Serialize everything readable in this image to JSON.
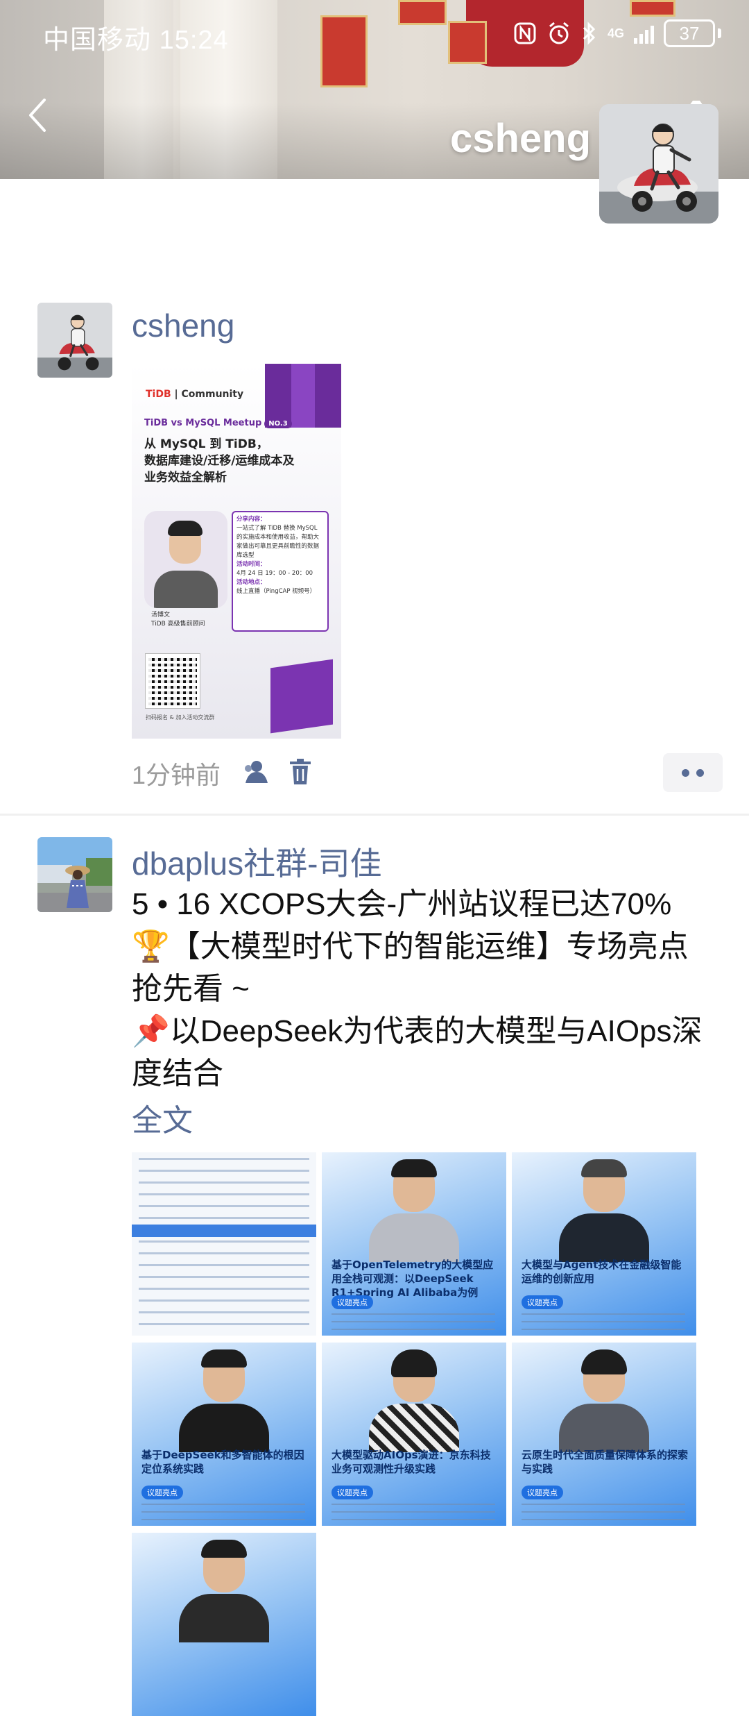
{
  "status_bar": {
    "carrier": "中国移动",
    "time": "15:24",
    "network": "4G",
    "battery": "37"
  },
  "header": {
    "cover_name": "csheng"
  },
  "posts": [
    {
      "author": "csheng",
      "image": {
        "brand_prefix": "TiDB",
        "brand_suffix": "| Community",
        "meetup": "TiDB vs MySQL Meetup",
        "meetup_no": "NO.3",
        "headline_1": "从 MySQL 到 TiDB，",
        "headline_2": "数据库建设/迁移/运维成本及",
        "headline_3": "业务效益全解析",
        "speaker_name": "汤博文",
        "speaker_title": "TiDB 高级售前顾问",
        "share_label": "分享内容：",
        "share_text": "一站式了解 TiDB 替换 MySQL 的实施成本和使用收益，帮助大家做出可靠且更具前瞻性的数据库选型",
        "time_label": "活动时间：",
        "time_text": "4月 24 日 19：00 - 20：00",
        "place_label": "活动地点：",
        "place_text": "线上直播（PingCAP 视频号）",
        "scan_text": "扫码报名 & 加入活动交流群"
      },
      "time": "1分钟前"
    },
    {
      "author": "dbaplus社群-司佳",
      "text_lines": [
        "5 • 16 XCOPS大会-广州站议程已达70%",
        "🏆【大模型时代下的智能运维】专场亮点",
        "抢先看 ~",
        "📌以DeepSeek为代表的大模型与AIOps深",
        "度结合"
      ],
      "full_text_link": "全文",
      "images": [
        {
          "type": "agenda"
        },
        {
          "title": "基于OpenTelemetry的大模型应用全栈可观测：以DeepSeek R1+Spring AI Alibaba为例",
          "tag": "议题亮点"
        },
        {
          "title": "大模型与Agent技术在金融级智能运维的创新应用",
          "tag": "议题亮点"
        },
        {
          "title": "基于DeepSeek和多智能体的根因定位系统实践",
          "tag": "议题亮点"
        },
        {
          "title": "大模型驱动AIOps演进：京东科技业务可观测性升级实践",
          "tag": "议题亮点"
        },
        {
          "title": "云原生时代全面质量保障体系的探索与实践",
          "tag": "议题亮点"
        }
      ]
    }
  ],
  "colors": {
    "link": "#576b95",
    "timestamp": "#9b9b9b",
    "tidb_purple": "#6a2c9b"
  },
  "icons": [
    "back-icon",
    "camera-icon",
    "nfc-icon",
    "alarm-icon",
    "bluetooth-icon",
    "signal-icon",
    "battery-icon",
    "privacy-icon",
    "delete-icon",
    "more-icon"
  ]
}
